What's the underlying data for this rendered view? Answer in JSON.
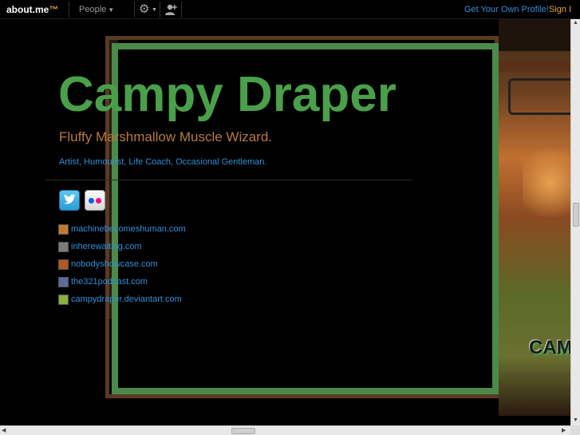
{
  "topbar": {
    "logo": "about.me",
    "logo_tm": "™",
    "people_label": "People",
    "get_profile_label": "Get Your Own Profile!",
    "signin_label": "Sign I"
  },
  "profile": {
    "name": "Campy Draper",
    "headline": "Fluffy Marshmallow Muscle Wizard.",
    "tagline": "Artist, Humourist, Life Coach, Occasional Gentleman.",
    "links": [
      {
        "label": "machinebecomeshuman.com",
        "icon": "site-favicon",
        "color": "#c07a30"
      },
      {
        "label": "inherewaiting.com",
        "icon": "site-favicon",
        "color": "#7a7a7a"
      },
      {
        "label": "nobodyshowcase.com",
        "icon": "site-favicon",
        "color": "#b05a20"
      },
      {
        "label": "the321podcast.com",
        "icon": "site-favicon",
        "color": "#5a6a9a"
      },
      {
        "label": "campydraper.deviantart.com",
        "icon": "deviantart-favicon",
        "color": "#8ab040"
      }
    ]
  },
  "photo": {
    "caption_text": "CAM"
  },
  "colors": {
    "name_green": "#4aa04a",
    "headline_brown": "#b77a3c",
    "link_blue": "#2f8fd8",
    "accent_orange": "#e8a33b"
  }
}
